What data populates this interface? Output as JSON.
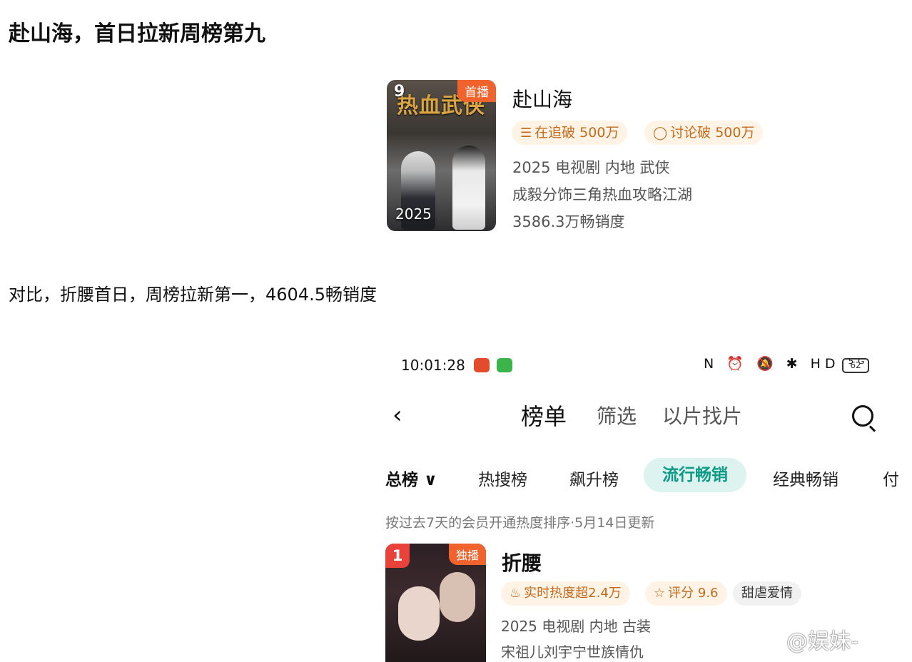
{
  "post": {
    "title": "赴山海，首日拉新周榜第九",
    "comparison": "对比，折腰首日，周榜拉新第一，4604.5畅销度"
  },
  "card1": {
    "rank": "9",
    "badge": "首播",
    "poster_art_title": "热血武侠",
    "year_overlay": "2025",
    "title": "赴山海",
    "tags": [
      {
        "icon": "list-check-icon",
        "label": "在追破 500万"
      },
      {
        "icon": "chat-bubble-icon",
        "label": "讨论破 500万"
      }
    ],
    "meta": "2025 电视剧 内地 武侠",
    "desc": "成毅分饰三角热血攻略江湖",
    "sales": "3586.3万畅销度"
  },
  "phone": {
    "status": {
      "time": "10:01:28",
      "battery": "62",
      "icons": "N ⏰ 🔕 ✱ HD ⁵ᴳ"
    },
    "nav": {
      "active": "榜单",
      "tabs": [
        "筛选",
        "以片找片"
      ]
    },
    "categories": [
      "总榜 ∨",
      "热搜榜",
      "飙升榜",
      "流行畅销",
      "经典畅销",
      "付"
    ],
    "active_category": "流行畅销",
    "subtitle": "按过去7天的会员开通热度排序·5月14日更新",
    "item": {
      "rank": "1",
      "badge": "独播",
      "title": "折腰",
      "tags": [
        {
          "icon": "flame-icon",
          "label": "实时热度超2.4万"
        },
        {
          "icon": "star-icon",
          "label": "评分 9.6"
        },
        {
          "icon": "",
          "label": "甜虐爱情"
        }
      ],
      "meta": "2025 电视剧 内地 古装",
      "desc": "宋祖儿刘宇宁世族情仇"
    }
  },
  "watermark": "@娱妹-",
  "colors": {
    "accent_orange": "#f0632c",
    "tag_orange": "#c46a1b",
    "pill_teal": "#0e9a87",
    "pill_bg": "#dcf3ef",
    "rank_red": "#e8423a"
  }
}
